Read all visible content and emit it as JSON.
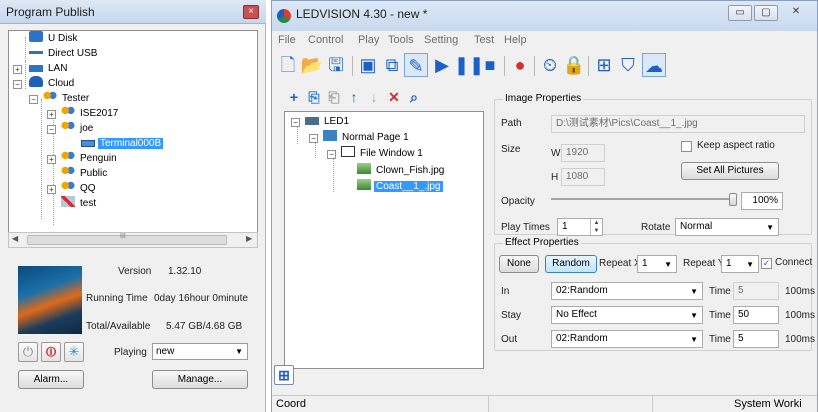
{
  "left_panel": {
    "title": "Program Publish",
    "close_glyph": "×",
    "tree": {
      "u_disk": "U Disk",
      "direct_usb": "Direct USB",
      "lan": "LAN",
      "cloud": "Cloud",
      "tester": "Tester",
      "ise2017": "ISE2017",
      "joe": "joe",
      "terminal": "Terminal000B",
      "penguin": "Penguin",
      "public": "Public",
      "qq": "QQ",
      "test": "test"
    },
    "scroll_center": "III",
    "version_label": "Version",
    "version_value": "1.32.10",
    "running_label": "Running Time",
    "running_value": "0day 16hour 0minute",
    "storage_label": "Total/Available",
    "storage_value": "5.47 GB/4.68 GB",
    "playing_label": "Playing",
    "playing_value": "new",
    "alarm_button": "Alarm...",
    "manage_button": "Manage..."
  },
  "window": {
    "title": "LEDVISION 4.30 - new *",
    "menu": [
      "File",
      "Control",
      "Play",
      "Tools",
      "Setting",
      "Test",
      "Help"
    ],
    "minimize": "▭",
    "maximize": "▢",
    "close": "✕"
  },
  "page_tree": {
    "led": "LED1",
    "page": "Normal Page 1",
    "window": "File Window 1",
    "file1": "Clown_Fish.jpg",
    "file2": "Coast__1_.jpg"
  },
  "image_properties": {
    "group_title": "Image Properties",
    "path_label": "Path",
    "path_value": "D:\\测试素材\\Pics\\Coast__1_.jpg",
    "size_label": "Size",
    "w_label": "W",
    "w_value": "1920",
    "h_label": "H",
    "h_value": "1080",
    "keep_aspect_label": "Keep aspect ratio",
    "keep_aspect_checked": false,
    "set_all_button": "Set All Pictures",
    "opacity_label": "Opacity",
    "opacity_value": "100%",
    "opacity_fraction": 1.0,
    "play_times_label": "Play Times",
    "play_times_value": "1",
    "rotate_label": "Rotate",
    "rotate_value": "Normal"
  },
  "effect_properties": {
    "group_title": "Effect Properties",
    "none_button": "None",
    "random_button": "Random",
    "repeat_x_label": "Repeat X",
    "repeat_x_value": "1",
    "repeat_y_label": "Repeat Y",
    "repeat_y_value": "1",
    "connect_label": "Connect",
    "connect_checked": true,
    "in_label": "In",
    "in_value": "02:Random",
    "in_time": "5",
    "stay_label": "Stay",
    "stay_value": "No Effect",
    "stay_time": "50",
    "out_label": "Out",
    "out_value": "02:Random",
    "out_time": "5",
    "time_label": "Time",
    "unit": "100ms"
  },
  "status": {
    "coord": "Coord",
    "state": "System Worki"
  }
}
